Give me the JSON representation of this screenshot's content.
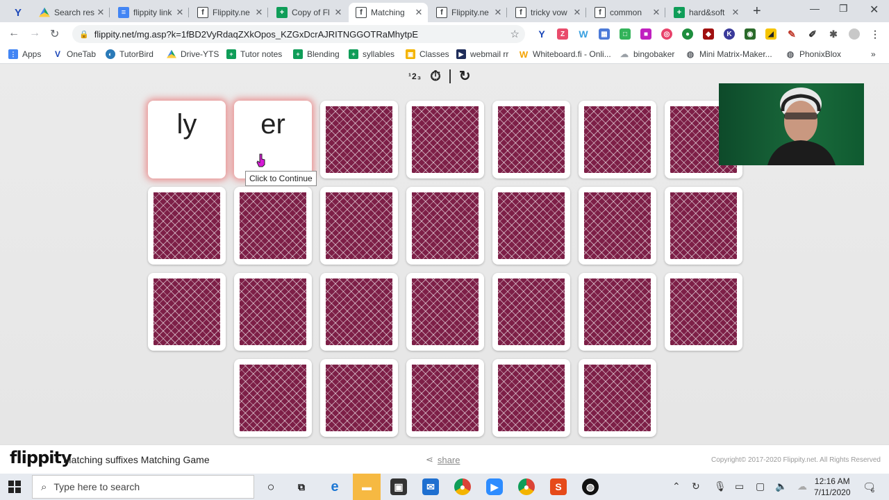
{
  "browser": {
    "tabs": [
      {
        "label": "",
        "icon": "y-icon",
        "active": false
      },
      {
        "label": "Search res",
        "icon": "drive-icon",
        "active": false
      },
      {
        "label": "flippity link",
        "icon": "doc-icon",
        "active": false
      },
      {
        "label": "Flippity.ne",
        "icon": "flippity-icon",
        "active": false
      },
      {
        "label": "Copy of Fl",
        "icon": "sheet-icon",
        "active": false
      },
      {
        "label": "Matching",
        "icon": "flippity-icon",
        "active": true
      },
      {
        "label": "Flippity.ne",
        "icon": "flippity-icon",
        "active": false
      },
      {
        "label": "tricky vow",
        "icon": "flippity-icon",
        "active": false
      },
      {
        "label": "common",
        "icon": "flippity-icon",
        "active": false
      },
      {
        "label": "hard&soft",
        "icon": "sheet-icon",
        "active": false
      }
    ],
    "url": "flippity.net/mg.asp?k=1fBD2VyRdaqZXkOpos_KZGxDcrAJRITNGGOTRaMhytpE",
    "bookmarks": [
      {
        "label": "Apps",
        "icon": "apps-icon",
        "color": "#4285f4"
      },
      {
        "label": "OneTab",
        "icon": "onetab-icon",
        "color": "#1a46b8"
      },
      {
        "label": "TutorBird",
        "icon": "tutorbird-icon",
        "color": "#2a7ab8"
      },
      {
        "label": "Drive-YTS",
        "icon": "drive-icon",
        "color": "#1fa463"
      },
      {
        "label": "Tutor notes",
        "icon": "sheet-icon",
        "color": "#0f9d58"
      },
      {
        "label": "Blending",
        "icon": "sheet-icon",
        "color": "#0f9d58"
      },
      {
        "label": "syllables",
        "icon": "sheet-icon",
        "color": "#0f9d58"
      },
      {
        "label": "Classes",
        "icon": "classroom-icon",
        "color": "#f4b400"
      },
      {
        "label": "webmail rr",
        "icon": "webmail-icon",
        "color": "#1f2d5a"
      },
      {
        "label": "Whiteboard.fi - Onli...",
        "icon": "whiteboard-icon",
        "color": "#f4a300"
      },
      {
        "label": "bingobaker",
        "icon": "cloud-icon",
        "color": "#9aa0a6"
      },
      {
        "label": "Mini Matrix-Maker...",
        "icon": "globe-icon",
        "color": "#5f6368"
      },
      {
        "label": "PhonixBlox",
        "icon": "globe-icon",
        "color": "#5f6368"
      }
    ]
  },
  "game": {
    "revealed_cards": [
      "ly",
      "er"
    ],
    "tooltip": "Click to Continue",
    "controls": {
      "numbers": "¹2₃",
      "timer_icon": "timer-icon",
      "restart_icon": "restart-icon"
    },
    "card_back_color": "#7d1f47"
  },
  "footer": {
    "logo": "flippity",
    "title": "Matching suffixes Matching Game",
    "share": "share",
    "copyright": "Copyright© 2017-2020 Flippity.net. All Rights Reserved"
  },
  "taskbar": {
    "search_placeholder": "Type here to search",
    "time": "12:16 AM",
    "date": "7/11/2020",
    "notification_count": "6"
  }
}
